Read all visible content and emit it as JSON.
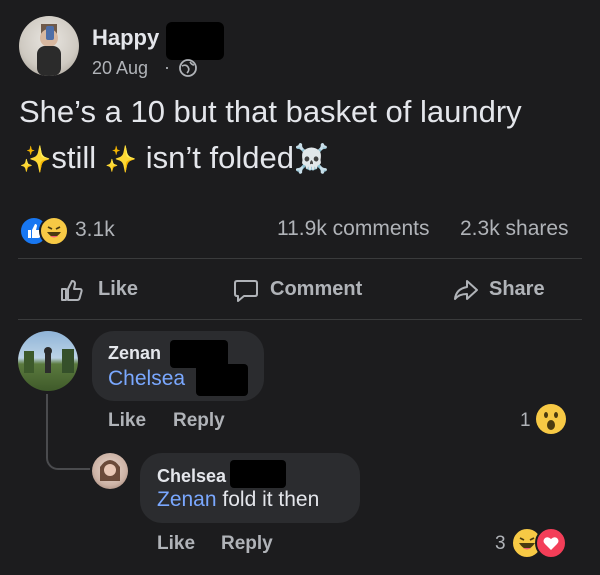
{
  "post": {
    "author_name": "Happy",
    "date": "20 Aug",
    "separator": "·",
    "text_line1": "She’s a 10 but that basket of laundry",
    "text_line2_a": "still",
    "text_line2_b": "isn’t folded",
    "sparkle_glyph": "✨",
    "skull_glyph": "☠️",
    "reaction_count": "3.1k",
    "comments_count": "11.9k comments",
    "shares_count": "2.3k shares",
    "actions": {
      "like": "Like",
      "comment": "Comment",
      "share": "Share"
    }
  },
  "comments": [
    {
      "author": "Zenan",
      "mention": "Chelsea",
      "text": "",
      "like_label": "Like",
      "reply_label": "Reply",
      "reaction_count": "1",
      "reaction_glyph": "😮"
    },
    {
      "author": "Chelsea",
      "mention": "Zenan",
      "text": "fold it then",
      "like_label": "Like",
      "reply_label": "Reply",
      "reaction_count": "3"
    }
  ],
  "icons": {
    "like_reaction": "like-reaction-icon",
    "haha_reaction": "haha-reaction-icon",
    "wow_reaction": "wow-reaction-icon",
    "love_reaction": "love-reaction-icon",
    "globe": "globe-icon"
  },
  "colors": {
    "background": "#1c1c1e",
    "link": "#7aa8ff",
    "like_blue": "#1877f2",
    "love_red": "#f33e58",
    "haha_yellow": "#f7c945"
  }
}
